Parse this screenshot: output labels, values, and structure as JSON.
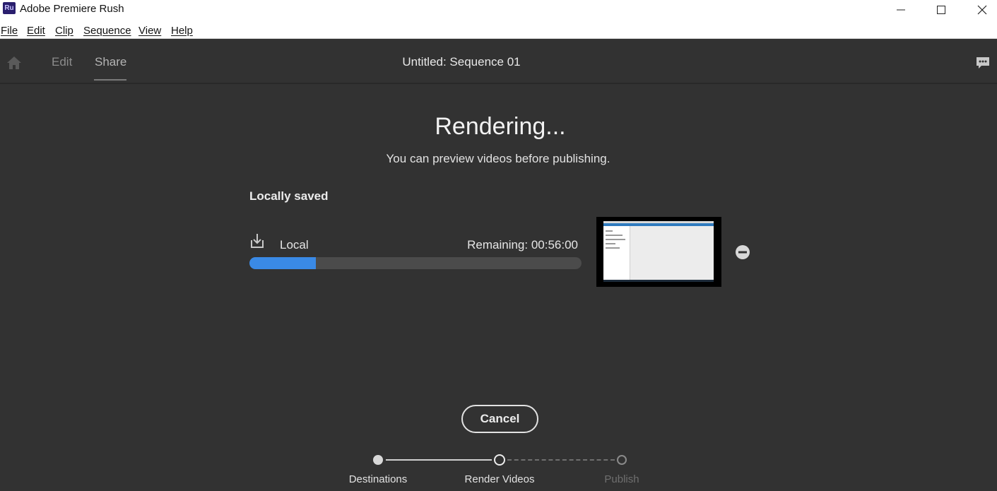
{
  "window": {
    "title": "Adobe Premiere Rush",
    "logo_text": "Ru"
  },
  "menu": {
    "items": [
      "File",
      "Edit",
      "Clip",
      "Sequence",
      "View",
      "Help"
    ]
  },
  "header": {
    "tabs": [
      "Edit",
      "Share"
    ],
    "active_tab": "Share",
    "sequence_title": "Untitled: Sequence 01"
  },
  "render": {
    "heading": "Rendering...",
    "subheading": "You can preview videos before publishing.",
    "section_title": "Locally saved",
    "destination": {
      "name": "Local",
      "remaining": "Remaining: 00:56:00",
      "progress_fraction": 0.2
    },
    "cancel_label": "Cancel"
  },
  "steps": [
    {
      "label": "Destinations",
      "state": "done"
    },
    {
      "label": "Render Videos",
      "state": "current"
    },
    {
      "label": "Publish",
      "state": "todo"
    }
  ],
  "colors": {
    "background": "#323232",
    "accent": "#3a8ae6",
    "track": "#4b4b4b"
  },
  "icons": {
    "home": "home-icon",
    "chat": "chat-icon",
    "download": "download-icon",
    "remove": "remove-icon",
    "minimize": "minimize-icon",
    "maximize": "maximize-icon",
    "close": "close-icon"
  }
}
